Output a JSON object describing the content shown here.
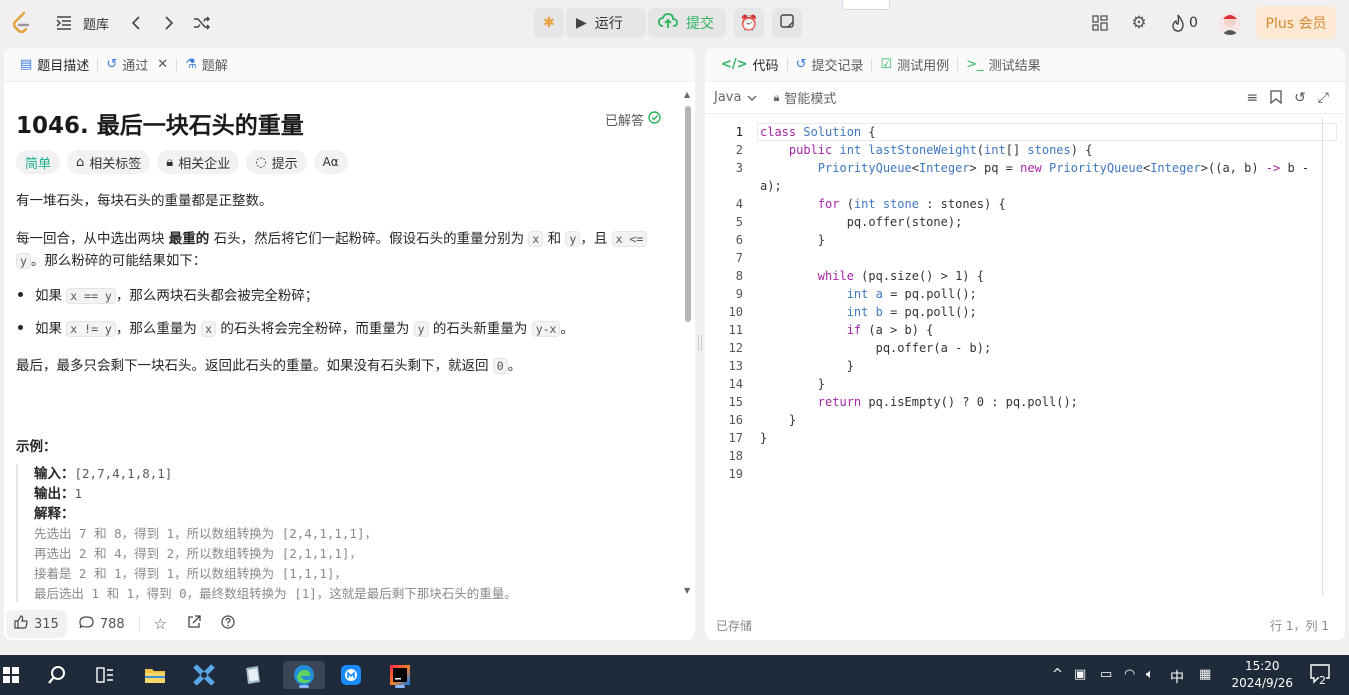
{
  "topbar": {
    "problem_list_label": "题库",
    "run_label": "运行",
    "submit_label": "提交",
    "streak_count": "0",
    "plus_label": "Plus 会员"
  },
  "left_tabs": {
    "description": "题目描述",
    "accepted": "通过",
    "solutions": "题解"
  },
  "problem": {
    "title": "1046. 最后一块石头的重量",
    "status": "已解答",
    "difficulty": "简单",
    "chips": [
      "相关标签",
      "相关企业",
      "提示"
    ],
    "p1": "有一堆石头，每块石头的重量都是正整数。",
    "p2_a": "每一回合，从中选出两块 ",
    "p2_bold": "最重的",
    "p2_b": " 石头，然后将它们一起粉碎。假设石头的重量分别为 ",
    "p2_x": "x",
    "p2_and": " 和 ",
    "p2_y": "y",
    "p2_c": "，且 ",
    "p2_cond": "x <=",
    "p2_y2": "y",
    "p2_d": "。那么粉碎的可能结果如下：",
    "b1_a": "如果 ",
    "b1_code": "x == y",
    "b1_b": "，那么两块石头都会被完全粉碎；",
    "b2_a": "如果 ",
    "b2_code": "x != y",
    "b2_b": "，那么重量为 ",
    "b2_x": "x",
    "b2_c": " 的石头将会完全粉碎，而重量为 ",
    "b2_y": "y",
    "b2_d": " 的石头新重量为 ",
    "b2_res": "y-x",
    "b2_e": "。",
    "p3_a": "最后，最多只会剩下一块石头。返回此石头的重量。如果没有石头剩下，就返回 ",
    "p3_zero": "0",
    "p3_b": "。",
    "example_heading": "示例：",
    "ex_input_label": "输入：",
    "ex_input": "[2,7,4,1,8,1]",
    "ex_output_label": "输出：",
    "ex_output": "1",
    "ex_explain_label": "解释：",
    "ex_lines": [
      "先选出 7 和 8，得到 1，所以数组转换为 [2,4,1,1,1]，",
      "再选出 2 和 4，得到 2，所以数组转换为 [2,1,1,1]，",
      "接着是 2 和 1，得到 1，所以数组转换为 [1,1,1]，",
      "最后选出 1 和 1，得到 0，最终数组转换为 [1]，这就是最后剩下那块石头的重量。"
    ]
  },
  "footer": {
    "likes": "315",
    "comments": "788"
  },
  "right_tabs": {
    "code": "代码",
    "submissions": "提交记录",
    "testcases": "测试用例",
    "results": "测试结果"
  },
  "editor": {
    "language": "Java",
    "mode": "智能模式",
    "saved": "已存储",
    "cursor": "行 1，列 1",
    "line_numbers": [
      "1",
      "2",
      "3",
      "",
      "4",
      "5",
      "6",
      "7",
      "8",
      "9",
      "10",
      "11",
      "12",
      "13",
      "14",
      "15",
      "16",
      "17",
      "18",
      "19"
    ]
  },
  "taskbar": {
    "time": "15:20",
    "date": "2024/9/26",
    "ime": "中",
    "notif_count": "2"
  }
}
